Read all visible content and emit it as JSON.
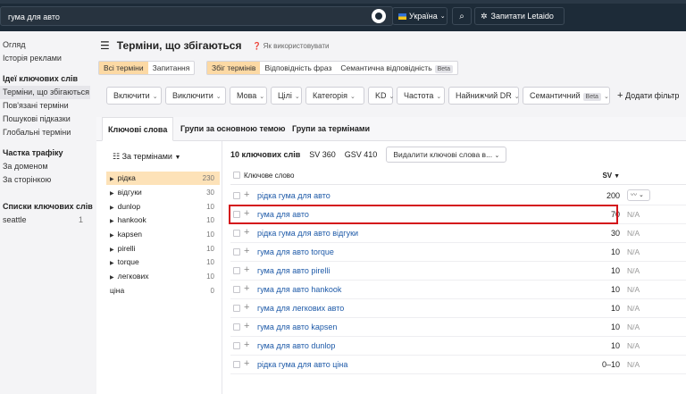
{
  "topbar": {
    "search_value": "гума для авто",
    "country": "Україна",
    "ask_label": "Запитати Letaido"
  },
  "sidebar": {
    "items_top": [
      "Огляд",
      "Історія реклами"
    ],
    "ideas_header": "Ідеї ключових слів",
    "ideas_items": [
      "Терміни, що збігаються",
      "Пов'язані терміни",
      "Пошукові підказки",
      "Глобальні терміни"
    ],
    "traffic_header": "Частка трафіку",
    "traffic_items": [
      "За доменом",
      "За сторінкою"
    ],
    "lists_header": "Списки ключових слів",
    "lists": [
      {
        "name": "seattle",
        "count": "1"
      }
    ]
  },
  "main": {
    "title": "Терміни, що збігаються",
    "howto": "Як використовувати",
    "seg1": [
      "Всі терміни",
      "Запитання"
    ],
    "seg2": [
      "Збіг термінів",
      "Відповідність фраз",
      "Семантична відповідність"
    ],
    "beta": "Beta",
    "filters": [
      "Включити",
      "Виключити",
      "Мова",
      "Цілі",
      "Категорія",
      "KD",
      "Частота",
      "Найнижчий DR",
      "Семантичний"
    ],
    "add_filter": "Додати фільтр",
    "tabs": [
      "Ключові слова",
      "Групи за основною темою",
      "Групи за термінами"
    ],
    "group_select": "За термінами",
    "groups": [
      {
        "name": "рідка",
        "count": "230"
      },
      {
        "name": "відгуки",
        "count": "30"
      },
      {
        "name": "dunlop",
        "count": "10"
      },
      {
        "name": "hankook",
        "count": "10"
      },
      {
        "name": "kapsen",
        "count": "10"
      },
      {
        "name": "pirelli",
        "count": "10"
      },
      {
        "name": "torque",
        "count": "10"
      },
      {
        "name": "легкових",
        "count": "10"
      },
      {
        "name": "ціна",
        "count": "0"
      }
    ],
    "summary": {
      "count": "10 ключових слів",
      "sv": "SV 360",
      "gsv": "GSV 410",
      "export": "Видалити ключові слова в..."
    },
    "col_keyword": "Ключове слово",
    "col_sv": "SV",
    "rows": [
      {
        "kw": "рідка гума для авто",
        "sv": "200",
        "trend": ""
      },
      {
        "kw": "гума для авто",
        "sv": "70",
        "trend": "N/A"
      },
      {
        "kw": "рідка гума для авто відгуки",
        "sv": "30",
        "trend": "N/A"
      },
      {
        "kw": "гума для авто torque",
        "sv": "10",
        "trend": "N/A"
      },
      {
        "kw": "гума для авто pirelli",
        "sv": "10",
        "trend": "N/A"
      },
      {
        "kw": "гума для авто hankook",
        "sv": "10",
        "trend": "N/A"
      },
      {
        "kw": "гума для легкових авто",
        "sv": "10",
        "trend": "N/A"
      },
      {
        "kw": "гума для авто kapsen",
        "sv": "10",
        "trend": "N/A"
      },
      {
        "kw": "гума для авто dunlop",
        "sv": "10",
        "trend": "N/A"
      },
      {
        "kw": "рідка гума для авто ціна",
        "sv": "0–10",
        "trend": "N/A"
      }
    ]
  }
}
